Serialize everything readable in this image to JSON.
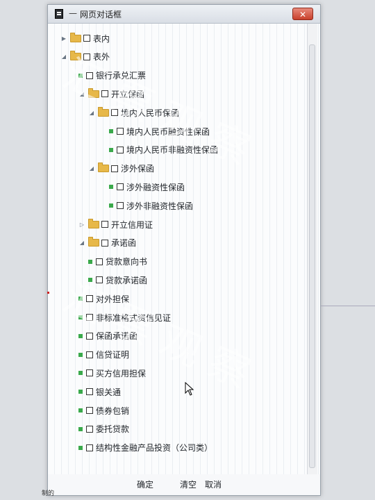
{
  "window": {
    "dash": "—",
    "title": "网页对话框",
    "close_label": "✕"
  },
  "tree": [
    {
      "label": "表内",
      "kind": "folder",
      "expander": "▶",
      "indent": 0
    },
    {
      "label": "表外",
      "kind": "folder",
      "expander": "◢",
      "indent": 0
    },
    {
      "label": "银行承兑汇票",
      "kind": "leaf",
      "indent": 1
    },
    {
      "label": "开立保函",
      "kind": "folder",
      "expander": "◢",
      "indent": 1
    },
    {
      "label": "境内人民币保函",
      "kind": "folder",
      "expander": "◢",
      "indent": 2
    },
    {
      "label": "境内人民币融资性保函",
      "kind": "leaf",
      "indent": 3
    },
    {
      "label": "境内人民币非融资性保函",
      "kind": "leaf",
      "indent": 3
    },
    {
      "label": "涉外保函",
      "kind": "folder",
      "expander": "◢",
      "indent": 2
    },
    {
      "label": "涉外融资性保函",
      "kind": "leaf",
      "indent": 3
    },
    {
      "label": "涉外非融资性保函",
      "kind": "leaf",
      "indent": 3
    },
    {
      "label": "开立信用证",
      "kind": "folder",
      "expander": "▷",
      "indent": 1
    },
    {
      "label": "承诺函",
      "kind": "folder",
      "expander": "◢",
      "indent": 1
    },
    {
      "label": "贷款意向书",
      "kind": "leaf",
      "indent": 2
    },
    {
      "label": "贷款承诺函",
      "kind": "leaf",
      "indent": 2
    },
    {
      "label": "对外担保",
      "kind": "leaf",
      "indent": 1
    },
    {
      "label": "非标准格式资信见证",
      "kind": "leaf",
      "indent": 1
    },
    {
      "label": "保函承诺函",
      "kind": "leaf",
      "indent": 1
    },
    {
      "label": "信贷证明",
      "kind": "leaf",
      "indent": 1
    },
    {
      "label": "买方信用担保",
      "kind": "leaf",
      "indent": 1
    },
    {
      "label": "银关通",
      "kind": "leaf",
      "indent": 1
    },
    {
      "label": "债券包销",
      "kind": "leaf",
      "indent": 1
    },
    {
      "label": "委托贷款",
      "kind": "leaf",
      "indent": 1
    },
    {
      "label": "结构性金融产品投资（公司类）",
      "kind": "leaf",
      "indent": 1
    }
  ],
  "buttons": {
    "confirm": "确定",
    "clear": "清空",
    "cancel": "取消"
  },
  "watermark": {
    "line1": "汇票观察",
    "line2": "汇票观察"
  },
  "bottom_left_label": "制的"
}
